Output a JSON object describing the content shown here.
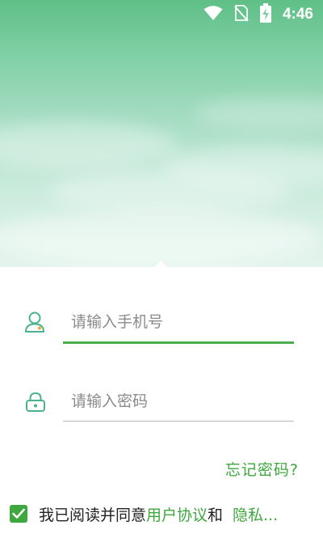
{
  "status_bar": {
    "time": "4:46",
    "icons": [
      "wifi-icon",
      "no-sim-icon",
      "battery-charging-icon"
    ]
  },
  "login": {
    "phone": {
      "placeholder": "请输入手机号",
      "icon": "user-icon"
    },
    "password": {
      "placeholder": "请输入密码",
      "icon": "lock-icon"
    },
    "forgot_password": "忘记密码?"
  },
  "agreement": {
    "checked": true,
    "prefix": "我已阅读并同意",
    "user_agreement": "用户协议",
    "and": "和",
    "privacy": "隐私..."
  },
  "colors": {
    "accent": "#3ea73e",
    "header_top": "#5fbf86",
    "header_bottom": "#e3f4ec",
    "icon_teal": "#4bb38a"
  }
}
